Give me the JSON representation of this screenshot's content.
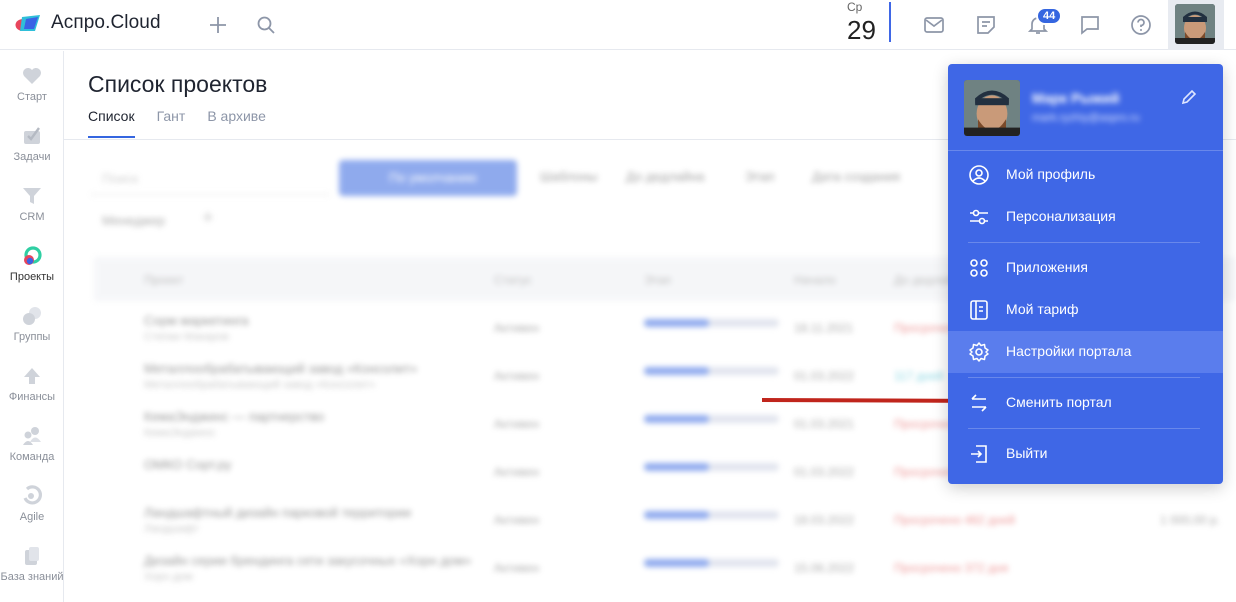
{
  "header": {
    "app_name": "Аспро.Cloud",
    "date_weekday": "Ср",
    "date_day": "29",
    "notifications_count": "44"
  },
  "sidebar": {
    "items": [
      {
        "label": "Старт",
        "icon": "heart-icon"
      },
      {
        "label": "Задачи",
        "icon": "tasks-icon"
      },
      {
        "label": "CRM",
        "icon": "funnel-icon"
      },
      {
        "label": "Проекты",
        "icon": "projects-icon"
      },
      {
        "label": "Группы",
        "icon": "groups-icon"
      },
      {
        "label": "Финансы",
        "icon": "finance-icon"
      },
      {
        "label": "Команда",
        "icon": "team-icon"
      },
      {
        "label": "Agile",
        "icon": "agile-icon"
      },
      {
        "label": "База знаний",
        "icon": "knowledge-icon"
      }
    ]
  },
  "main": {
    "title": "Список проектов",
    "tabs": [
      "Список",
      "Гант",
      "В архиве"
    ]
  },
  "blurred_bg": {
    "search_placeholder": "Поиск",
    "filter_btn": "По умолчанию",
    "chips": [
      "Шаблоны",
      "До дедлайна",
      "Этап",
      "Дата создания"
    ],
    "second_filter": "Менеджер",
    "columns": [
      "Проект",
      "Статус",
      "Этап",
      "Начало",
      "До дедлайна"
    ],
    "rows": [
      {
        "name": "Сорм маркетинга",
        "sub": "Степан Макаров",
        "status": "Активен",
        "progress": 0.48,
        "date": "18.11.2021",
        "deadline": "Просрочено",
        "ok": false,
        "sum": ""
      },
      {
        "name": "Металлообрабатывающий завод «Консолит»",
        "sub": "Металлообрабатывающий завод «Консолит»",
        "status": "Активен",
        "progress": 0.48,
        "date": "01.03.2022",
        "deadline": "117 дней",
        "ok": true,
        "sum": ""
      },
      {
        "name": "КемаЭнджинс — партнерство",
        "sub": "КемаЭнджинс",
        "status": "Активен",
        "progress": 0.48,
        "date": "01.03.2021",
        "deadline": "Просрочено",
        "ok": false,
        "sum": ""
      },
      {
        "name": "ОМКО Сорт.ру",
        "sub": "",
        "status": "Активен",
        "progress": 0.48,
        "date": "01.03.2022",
        "deadline": "Просрочено",
        "ok": false,
        "sum": ""
      },
      {
        "name": "Ландшафтный дизайн парковой территории",
        "sub": "Ландшафт",
        "status": "Активен",
        "progress": 0.48,
        "date": "18.03.2022",
        "deadline": "Просрочено 482 дней",
        "ok": false,
        "sum": "1 000,00 р."
      },
      {
        "name": "Дизайн серии брендинга сети закусочных «Хорн дом»",
        "sub": "Хорн дом",
        "status": "Активен",
        "progress": 0.48,
        "date": "15.06.2022",
        "deadline": "Просрочено 372 дня",
        "ok": false,
        "sum": ""
      }
    ]
  },
  "user_menu": {
    "name": "Марк Рыжий",
    "email": "mark.ryzhiy@aspro.ru",
    "items": [
      {
        "label": "Мой профиль",
        "icon": "user-circle-icon"
      },
      {
        "label": "Персонализация",
        "icon": "sliders-icon"
      },
      {
        "label": "Приложения",
        "icon": "apps-grid-icon"
      },
      {
        "label": "Мой тариф",
        "icon": "tariff-icon"
      },
      {
        "label": "Настройки портала",
        "icon": "gear-icon"
      },
      {
        "label": "Сменить портал",
        "icon": "swap-icon"
      },
      {
        "label": "Выйти",
        "icon": "logout-icon"
      }
    ],
    "highlighted": "Настройки портала"
  },
  "colors": {
    "accent": "#3566e0",
    "menu_bg": "#3f67e6",
    "menu_highlight": "#5a7ded",
    "arrow": "#c0251c",
    "overdue": "#e04545"
  }
}
